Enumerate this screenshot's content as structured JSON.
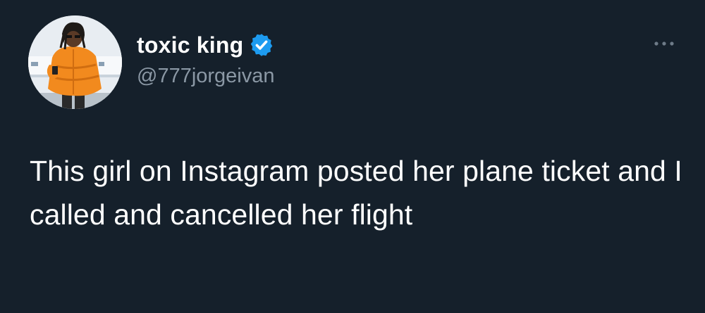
{
  "user": {
    "display_name": "toxic king",
    "handle": "@777jorgeivan",
    "verified": true,
    "avatar_icon": "profile-photo-person-orange-jacket"
  },
  "menu": {
    "icon": "more-options-icon"
  },
  "tweet": {
    "text": "This girl on Instagram posted her plane ticket and I called and cancelled her flight"
  },
  "colors": {
    "background": "#15202b",
    "verified_badge": "#1d9bf0",
    "handle_text": "#8b98a5",
    "body_text": "#ffffff"
  }
}
